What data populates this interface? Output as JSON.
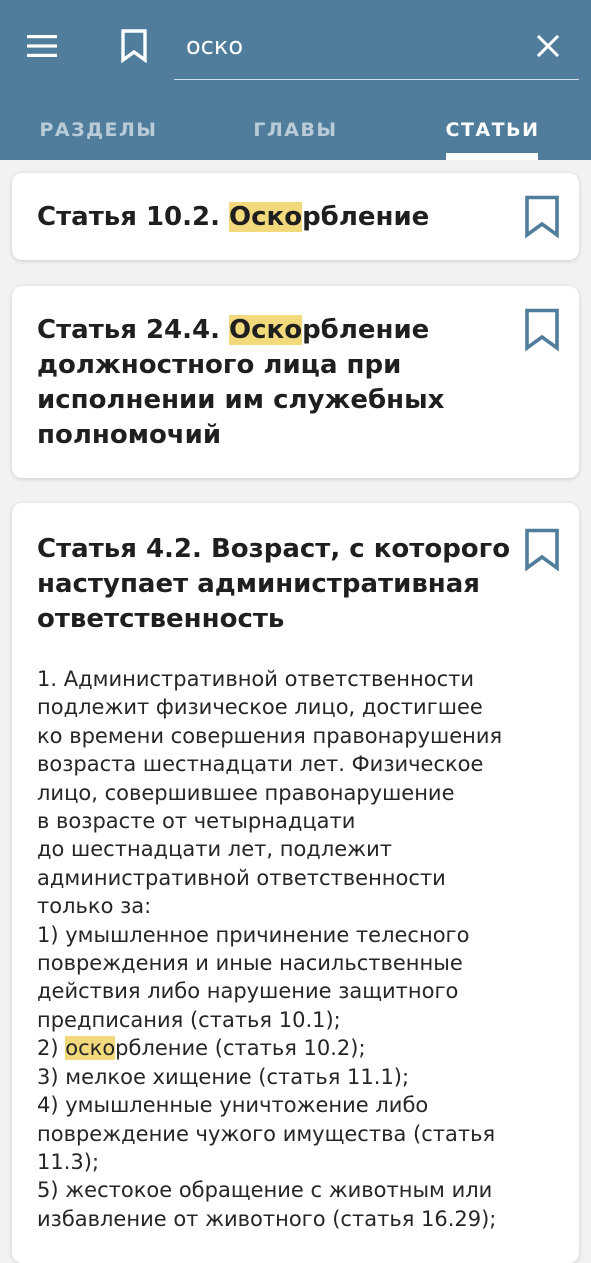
{
  "toolbar": {
    "menu_icon": "hamburger-menu-icon",
    "bookmarks_icon": "bookmark-icon",
    "search_value": "оско",
    "clear_icon": "close-icon"
  },
  "tabs": [
    {
      "label": "РАЗДЕЛЫ",
      "active": false
    },
    {
      "label": "ГЛАВЫ",
      "active": false
    },
    {
      "label": "СТАТЬИ",
      "active": true
    }
  ],
  "colors": {
    "appbar": "#4f7d9b",
    "highlight": "#f1d97c",
    "bookmark_icon": "#4f7d9b",
    "background": "#f2f2f2"
  },
  "results": [
    {
      "title": [
        {
          "text": "Статья 10.2. "
        },
        {
          "text": "Оско",
          "hl": true
        },
        {
          "text": "рбление"
        }
      ]
    },
    {
      "title": [
        {
          "text": "Статья 24.4. "
        },
        {
          "text": "Оско",
          "hl": true
        },
        {
          "text": "рбление\nдолжностного лица при\nисполнении им служебных\nполномочий"
        }
      ]
    },
    {
      "title": [
        {
          "text": "Статья 4.2. Возраст, с которого\nнаступает административная\nответственность"
        }
      ],
      "body": [
        [
          {
            "text": "1. Административной ответственности"
          }
        ],
        [
          {
            "text": "подлежит физическое лицо, достигшее"
          }
        ],
        [
          {
            "text": "ко времени совершения правонарушения"
          }
        ],
        [
          {
            "text": "возраста шестнадцати лет. Физическое"
          }
        ],
        [
          {
            "text": "лицо, совершившее правонарушение"
          }
        ],
        [
          {
            "text": "в возрасте от четырнадцати"
          }
        ],
        [
          {
            "text": "до шестнадцати лет, подлежит"
          }
        ],
        [
          {
            "text": "административной ответственности"
          }
        ],
        [
          {
            "text": "только за:"
          }
        ],
        [
          {
            "text": "1) умышленное причинение телесного"
          }
        ],
        [
          {
            "text": "повреждения и иные насильственные"
          }
        ],
        [
          {
            "text": "действия либо нарушение защитного"
          }
        ],
        [
          {
            "text": "предписания (статья 10.1);"
          }
        ],
        [
          {
            "text": "2) "
          },
          {
            "text": "оско",
            "hl": true
          },
          {
            "text": "рбление (статья 10.2);"
          }
        ],
        [
          {
            "text": "3) мелкое хищение (статья 11.1);"
          }
        ],
        [
          {
            "text": "4) умышленные уничтожение либо"
          }
        ],
        [
          {
            "text": "повреждение чужого имущества (статья"
          }
        ],
        [
          {
            "text": "11.3);"
          }
        ],
        [
          {
            "text": "5) жестокое обращение с животным или"
          }
        ],
        [
          {
            "text": "избавление от животного (статья 16.29);"
          }
        ]
      ]
    }
  ]
}
